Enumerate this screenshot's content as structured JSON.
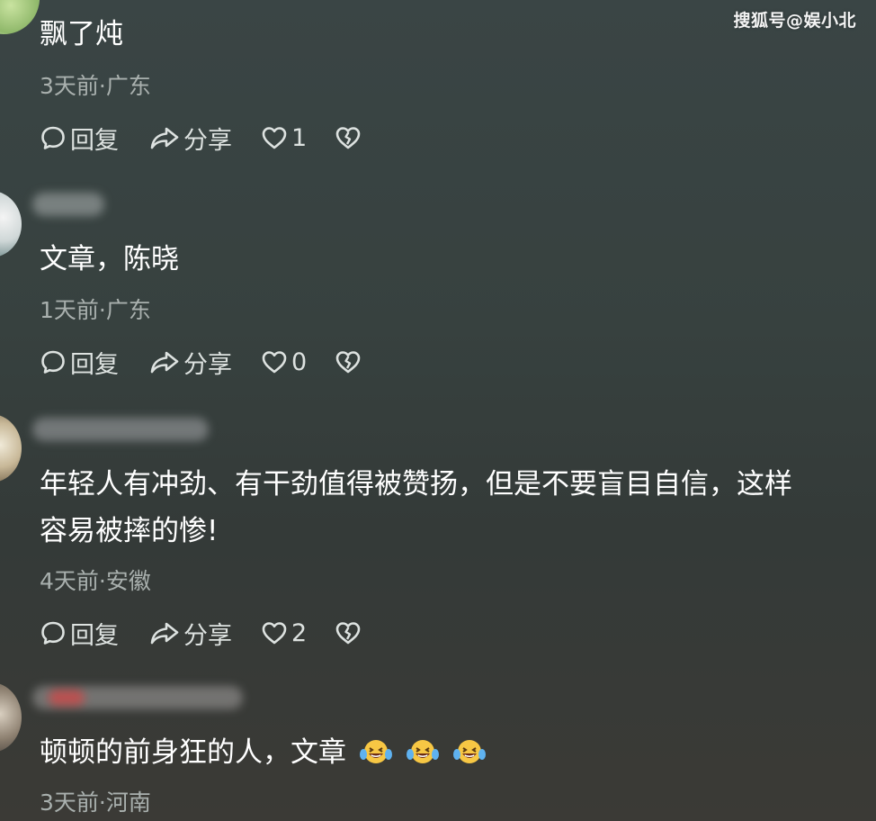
{
  "watermark": "搜狐号@娱小北",
  "comments": [
    {
      "text": "飘了炖",
      "time_location": "3天前·广东",
      "reply_label": "回复",
      "share_label": "分享",
      "like_count": "1"
    },
    {
      "text": "文章，陈晓",
      "time_location": "1天前·广东",
      "reply_label": "回复",
      "share_label": "分享",
      "like_count": "0"
    },
    {
      "text_line1": "年轻人有冲劲、有干劲值得被赞扬，但是不要盲目自信，这样",
      "text_line2": "容易被摔的惨!",
      "time_location": "4天前·安徽",
      "reply_label": "回复",
      "share_label": "分享",
      "like_count": "2"
    },
    {
      "text": "顿顿的前身狂的人，文章",
      "emojis": [
        "laughing-tears-emoji",
        "laughing-tears-emoji",
        "laughing-tears-emoji"
      ],
      "time_location": "3天前·河南"
    }
  ],
  "icons": {
    "reply": "speech-bubble-icon",
    "share": "share-arrow-icon",
    "like": "heart-outline-icon",
    "dislike": "broken-heart-icon"
  },
  "colors": {
    "text": "#ffffff",
    "meta": "#a9b0ae",
    "action": "#dde2e0"
  }
}
